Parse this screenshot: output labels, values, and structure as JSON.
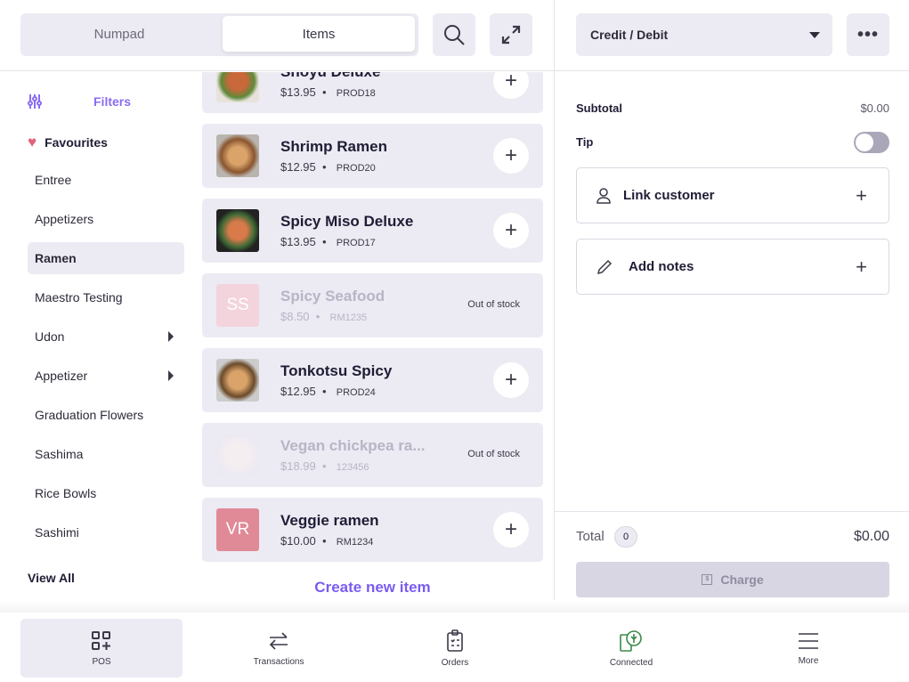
{
  "header": {
    "tabs": [
      {
        "label": "Numpad"
      },
      {
        "label": "Items"
      }
    ],
    "search_icon": "search-icon",
    "expand_icon": "expand-icon"
  },
  "payment": {
    "method": "Credit / Debit",
    "more_icon": "more-horizontal-icon"
  },
  "sidebar": {
    "filters": "Filters",
    "favourites": "Favourites",
    "categories": [
      {
        "label": "Entree"
      },
      {
        "label": "Appetizers"
      },
      {
        "label": "Ramen",
        "selected": true
      },
      {
        "label": "Maestro Testing"
      },
      {
        "label": "Udon",
        "has_sub": true
      },
      {
        "label": "Appetizer",
        "has_sub": true
      },
      {
        "label": "Graduation Flowers"
      },
      {
        "label": "Sashima"
      },
      {
        "label": "Rice Bowls"
      },
      {
        "label": "Sashimi"
      }
    ],
    "view_all": "View All"
  },
  "items": [
    {
      "name": "Shoyu Deluxe",
      "price": "$13.95",
      "code": "PROD18",
      "in_stock": true
    },
    {
      "name": "Shrimp Ramen",
      "price": "$12.95",
      "code": "PROD20",
      "in_stock": true
    },
    {
      "name": "Spicy Miso Deluxe",
      "price": "$13.95",
      "code": "PROD17",
      "in_stock": true
    },
    {
      "name": "Spicy Seafood",
      "price": "$8.50",
      "code": "RM1235",
      "in_stock": false,
      "initials": "SS",
      "status": "Out of stock"
    },
    {
      "name": "Tonkotsu Spicy",
      "price": "$12.95",
      "code": "PROD24",
      "in_stock": true
    },
    {
      "name": "Vegan chickpea ra...",
      "price": "$18.99",
      "code": "123456",
      "in_stock": false,
      "status": "Out of stock"
    },
    {
      "name": "Veggie ramen",
      "price": "$10.00",
      "code": "RM1234",
      "in_stock": true,
      "initials": "VR"
    }
  ],
  "create_item": "Create new item",
  "cart": {
    "subtotal_label": "Subtotal",
    "subtotal": "$0.00",
    "tip_label": "Tip",
    "tip_enabled": false,
    "link_customer": "Link customer",
    "add_notes": "Add notes",
    "total_label": "Total",
    "count": "0",
    "total": "$0.00",
    "charge": "Charge"
  },
  "nav": [
    {
      "label": "POS",
      "active": true
    },
    {
      "label": "Transactions"
    },
    {
      "label": "Orders"
    },
    {
      "label": "Connected"
    },
    {
      "label": "More"
    }
  ],
  "colors": {
    "accent": "#7b5cf0",
    "bg_tint": "#ecebf3",
    "connected": "#3b8a4a",
    "heart": "#e0647a"
  }
}
